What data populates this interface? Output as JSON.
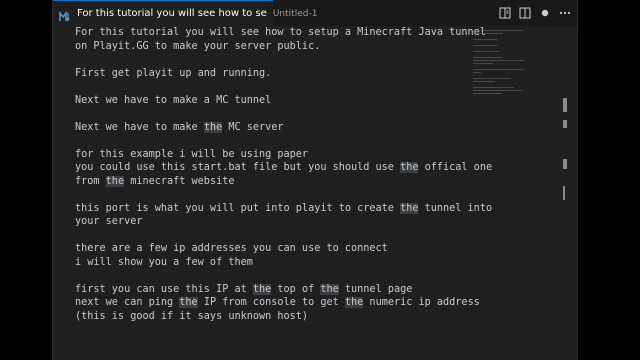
{
  "tab": {
    "title": "For this tutorial you will see how to se",
    "description": "Untitled-1",
    "icon": "markdown-file-icon"
  },
  "actions": [
    {
      "name": "open-preview-icon"
    },
    {
      "name": "split-editor-icon"
    },
    {
      "name": "unsaved-dot-icon"
    },
    {
      "name": "more-actions-icon"
    }
  ],
  "lines": [
    [
      "For this tutorial you will see how to setup a Minecraft Java tunnel"
    ],
    [
      "on Playit.GG to make your server public."
    ],
    [
      ""
    ],
    [
      "First get playit up and running."
    ],
    [
      ""
    ],
    [
      "Next we have to make a MC tunnel"
    ],
    [
      ""
    ],
    [
      "Next we have to make ",
      {
        "hl": "the"
      },
      " MC server"
    ],
    [
      ""
    ],
    [
      "for this example i will be using paper"
    ],
    [
      "you could use this start.bat file but you should use ",
      {
        "hl": "the"
      },
      " offical one"
    ],
    [
      "from ",
      {
        "hl": "the"
      },
      " minecraft website"
    ],
    [
      ""
    ],
    [
      "this port is what you will put into playit to create ",
      {
        "hl": "the"
      },
      " tunnel into"
    ],
    [
      "your server"
    ],
    [
      ""
    ],
    [
      "there are a few ip addresses you can use to connect"
    ],
    [
      "i will show you a few of them"
    ],
    [
      ""
    ],
    [
      "first you can use this IP at ",
      {
        "hl": "the"
      },
      " top of ",
      {
        "hl": "the"
      },
      " tunnel page"
    ],
    [
      "next we can ping ",
      {
        "hl": "the"
      },
      " IP from console to get ",
      {
        "hl": "the"
      },
      " numeric ip address"
    ],
    [
      "(this is good if it says unknown host)"
    ]
  ]
}
